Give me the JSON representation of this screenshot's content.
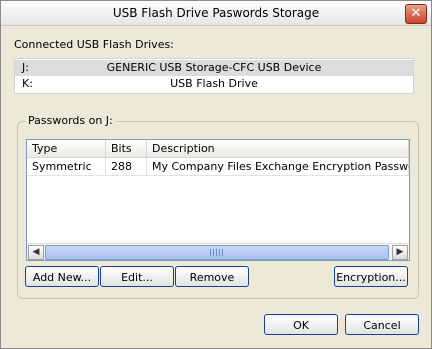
{
  "window": {
    "title": "USB Flash Drive Paswords Storage"
  },
  "drives": {
    "label": "Connected USB Flash Drives:",
    "items": [
      {
        "letter": "J:",
        "name": "GENERIC USB Storage-CFC USB Device",
        "selected": true
      },
      {
        "letter": "K:",
        "name": "USB Flash Drive",
        "selected": false
      }
    ]
  },
  "passwords": {
    "group_label": "Passwords on J:",
    "columns": [
      "Type",
      "Bits",
      "Description"
    ],
    "rows": [
      {
        "type": "Symmetric",
        "bits": "288",
        "description": "My Company Files Exchange Encryption Password"
      }
    ]
  },
  "buttons": {
    "add_new": "Add New...",
    "edit": "Edit...",
    "remove": "Remove",
    "encryption": "Encryption...",
    "ok": "OK",
    "cancel": "Cancel"
  },
  "icons": {
    "close": "close-icon",
    "scroll_left": "scroll-left-icon",
    "scroll_right": "scroll-right-icon"
  }
}
